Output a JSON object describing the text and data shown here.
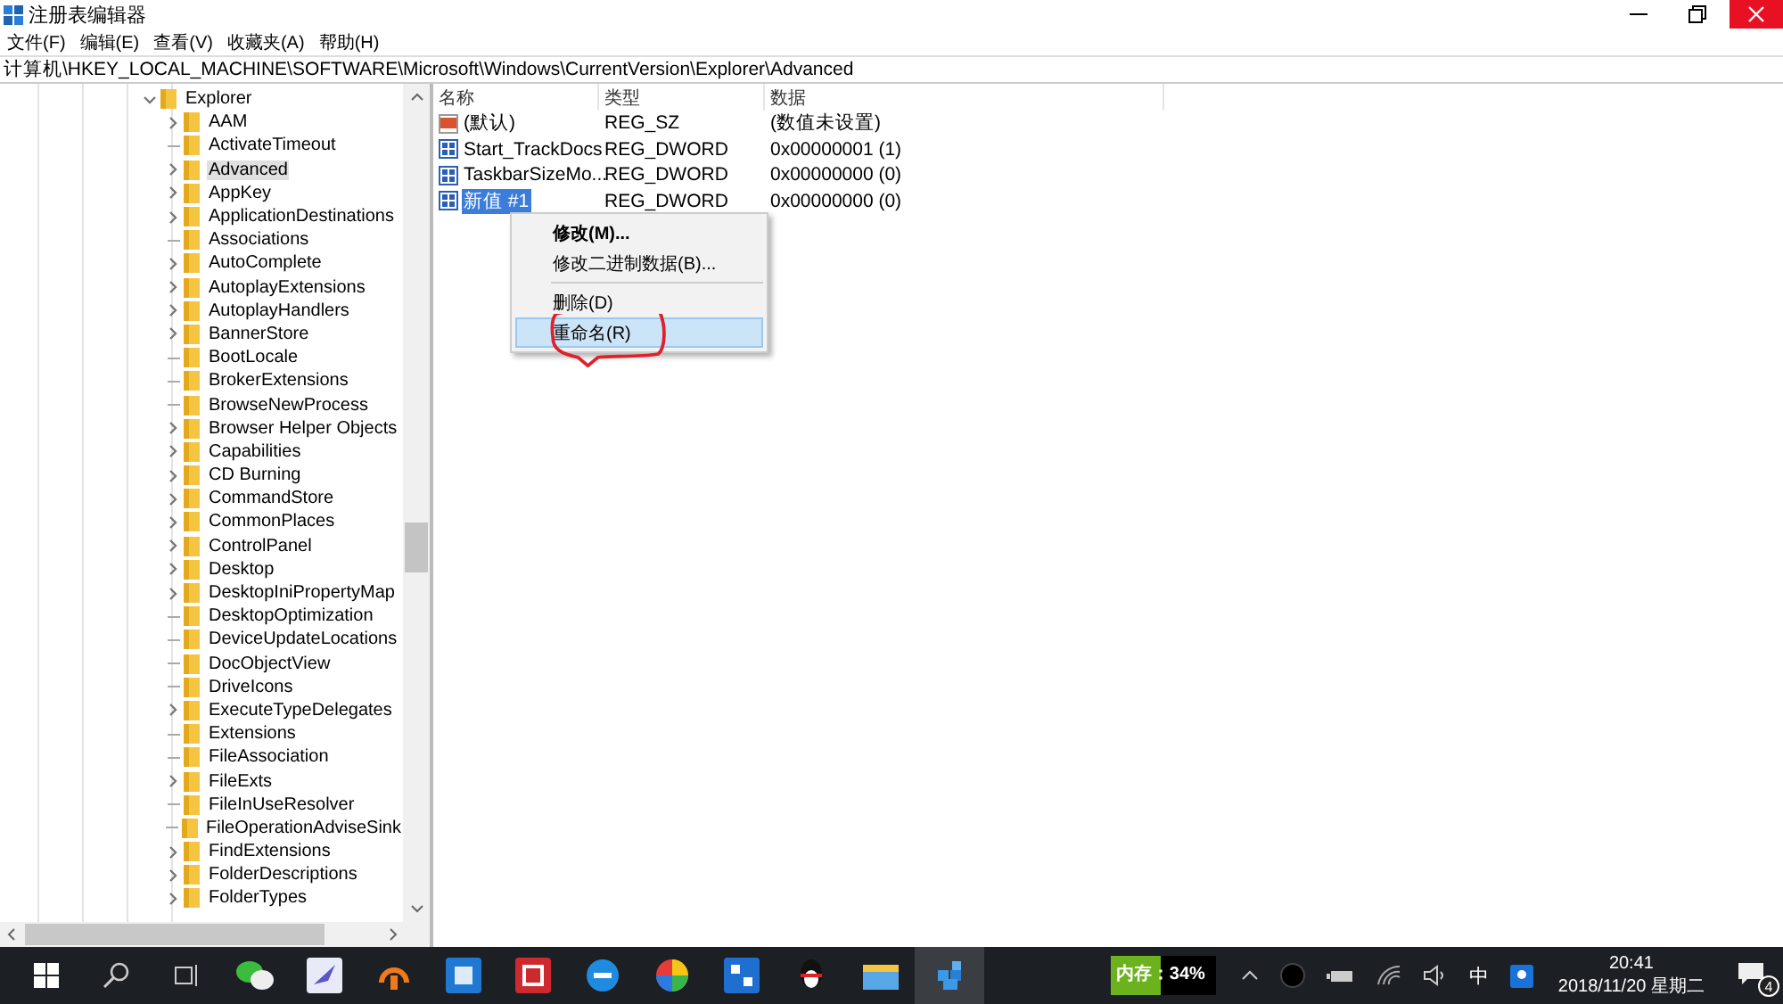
{
  "window": {
    "title": "注册表编辑器"
  },
  "menu": [
    "文件(F)",
    "编辑(E)",
    "查看(V)",
    "收藏夹(A)",
    "帮助(H)"
  ],
  "address": "计算机\\HKEY_LOCAL_MACHINE\\SOFTWARE\\Microsoft\\Windows\\CurrentVersion\\Explorer\\Advanced",
  "tree": [
    {
      "label": "Explorer",
      "expanded": true,
      "selected": false,
      "children": [
        {
          "label": "AAM",
          "expandable": true,
          "selected": false
        },
        {
          "label": "ActivateTimeout",
          "expandable": false,
          "selected": false
        },
        {
          "label": "Advanced",
          "expandable": true,
          "selected": true
        },
        {
          "label": "AppKey",
          "expandable": true,
          "selected": false
        },
        {
          "label": "ApplicationDestinations",
          "expandable": true,
          "selected": false
        },
        {
          "label": "Associations",
          "expandable": false,
          "selected": false
        },
        {
          "label": "AutoComplete",
          "expandable": true,
          "selected": false
        },
        {
          "label": "AutoplayExtensions",
          "expandable": true,
          "selected": false
        },
        {
          "label": "AutoplayHandlers",
          "expandable": true,
          "selected": false
        },
        {
          "label": "BannerStore",
          "expandable": true,
          "selected": false
        },
        {
          "label": "BootLocale",
          "expandable": false,
          "selected": false
        },
        {
          "label": "BrokerExtensions",
          "expandable": false,
          "selected": false
        },
        {
          "label": "BrowseNewProcess",
          "expandable": false,
          "selected": false
        },
        {
          "label": "Browser Helper Objects",
          "expandable": true,
          "selected": false
        },
        {
          "label": "Capabilities",
          "expandable": true,
          "selected": false
        },
        {
          "label": "CD Burning",
          "expandable": true,
          "selected": false
        },
        {
          "label": "CommandStore",
          "expandable": true,
          "selected": false
        },
        {
          "label": "CommonPlaces",
          "expandable": true,
          "selected": false
        },
        {
          "label": "ControlPanel",
          "expandable": true,
          "selected": false
        },
        {
          "label": "Desktop",
          "expandable": true,
          "selected": false
        },
        {
          "label": "DesktopIniPropertyMap",
          "expandable": true,
          "selected": false
        },
        {
          "label": "DesktopOptimization",
          "expandable": false,
          "selected": false
        },
        {
          "label": "DeviceUpdateLocations",
          "expandable": false,
          "selected": false
        },
        {
          "label": "DocObjectView",
          "expandable": false,
          "selected": false
        },
        {
          "label": "DriveIcons",
          "expandable": false,
          "selected": false
        },
        {
          "label": "ExecuteTypeDelegates",
          "expandable": true,
          "selected": false
        },
        {
          "label": "Extensions",
          "expandable": false,
          "selected": false
        },
        {
          "label": "FileAssociation",
          "expandable": false,
          "selected": false
        },
        {
          "label": "FileExts",
          "expandable": true,
          "selected": false
        },
        {
          "label": "FileInUseResolver",
          "expandable": false,
          "selected": false
        },
        {
          "label": "FileOperationAdviseSink",
          "expandable": false,
          "selected": false
        },
        {
          "label": "FindExtensions",
          "expandable": true,
          "selected": false
        },
        {
          "label": "FolderDescriptions",
          "expandable": true,
          "selected": false
        },
        {
          "label": "FolderTypes",
          "expandable": true,
          "selected": false
        }
      ]
    }
  ],
  "values": {
    "columns": [
      "名称",
      "类型",
      "数据"
    ],
    "rows": [
      {
        "kind": "string",
        "name": "(默认)",
        "type": "REG_SZ",
        "data": "(数值未设置)",
        "selected": false
      },
      {
        "kind": "dword",
        "name": "Start_TrackDocs",
        "type": "REG_DWORD",
        "data": "0x00000001 (1)",
        "selected": false
      },
      {
        "kind": "dword",
        "name": "TaskbarSizeMo...",
        "type": "REG_DWORD",
        "data": "0x00000000 (0)",
        "selected": false
      },
      {
        "kind": "dword",
        "name": "新值 #1",
        "type": "REG_DWORD",
        "data": "0x00000000 (0)",
        "selected": true
      }
    ]
  },
  "context_menu": [
    {
      "label": "修改(M)...",
      "bold": true,
      "selected": false
    },
    {
      "label": "修改二进制数据(B)...",
      "bold": false,
      "selected": false
    },
    {
      "kind": "separator"
    },
    {
      "label": "删除(D)",
      "bold": false,
      "selected": false
    },
    {
      "label": "重命名(R)",
      "bold": false,
      "selected": true
    }
  ],
  "taskbar": {
    "memory": "内存：34%",
    "language": "中",
    "time": "20:41",
    "date": "2018/11/20 星期二",
    "notifications": "4"
  }
}
